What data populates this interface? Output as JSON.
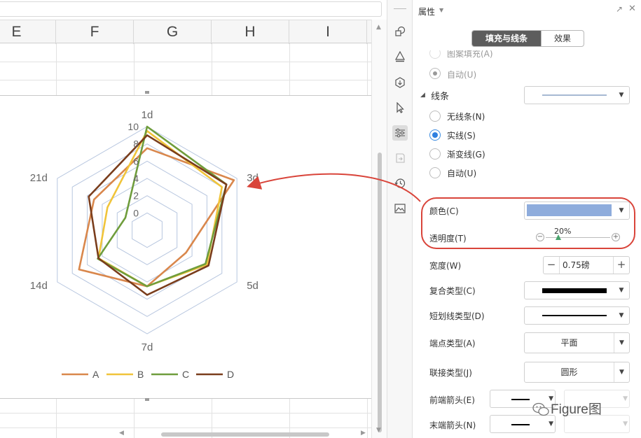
{
  "sheet": {
    "columns": [
      "E",
      "F",
      "G",
      "H",
      "I"
    ]
  },
  "chart_data": {
    "type": "radar",
    "categories": [
      "1d",
      "3d",
      "5d",
      "7d",
      "14d",
      "21d"
    ],
    "r_ticks": [
      "0",
      "2",
      "4",
      "6",
      "8",
      "10"
    ],
    "r_range": [
      -2,
      10
    ],
    "legend_position": "bottom",
    "series": [
      {
        "name": "A",
        "color": "#d9874c",
        "values": [
          7.5,
          9.6,
          3.2,
          4.5,
          7.1,
          5.1
        ]
      },
      {
        "name": "B",
        "color": "#f0c43a",
        "values": [
          9.5,
          8.0,
          6.0,
          4.5,
          4.5,
          3.3
        ]
      },
      {
        "name": "C",
        "color": "#6f9d3c",
        "values": [
          10.0,
          8.6,
          5.8,
          4.5,
          4.6,
          0.9
        ]
      },
      {
        "name": "D",
        "color": "#7a3d1c",
        "values": [
          9.0,
          8.6,
          6.2,
          5.5,
          4.5,
          5.8
        ]
      }
    ]
  },
  "toolbar": {
    "icons": [
      "shapes-icon",
      "fill-icon",
      "effects-icon",
      "select-icon",
      "properties-icon",
      "transform-icon",
      "history-icon",
      "image-icon"
    ]
  },
  "panel": {
    "title": "属性",
    "tabs": {
      "fill_line": "填充与线条",
      "effect": "效果"
    },
    "fill_radios": [
      {
        "label": "图案填充(A)",
        "checked": false
      },
      {
        "label": "自动(U)",
        "checked": true
      }
    ],
    "line_section": {
      "title": "线条",
      "line_color": "#a7b9d3"
    },
    "line_radios": [
      {
        "label": "无线条(N)",
        "checked": false
      },
      {
        "label": "实线(S)",
        "checked": true
      },
      {
        "label": "渐变线(G)",
        "checked": false
      },
      {
        "label": "自动(U)",
        "checked": false
      }
    ],
    "color": {
      "label": "颜色(C)",
      "value": "#8eacdc"
    },
    "transparency": {
      "label": "透明度(T)",
      "value": "20%",
      "fraction": 0.2
    },
    "width": {
      "label": "宽度(W)",
      "value": "0.75磅",
      "minus": "−",
      "plus": "+"
    },
    "compound": {
      "label": "复合类型(C)"
    },
    "dash": {
      "label": "短划线类型(D)"
    },
    "cap": {
      "label": "端点类型(A)",
      "value": "平面"
    },
    "join": {
      "label": "联接类型(J)",
      "value": "圆形"
    },
    "begin_arrow": {
      "label": "前端箭头(E)"
    },
    "end_arrow": {
      "label": "末端箭头(N)"
    }
  },
  "watermark": "Figure图",
  "colors": {
    "accent": "#2f80e0",
    "highlight": "#d9443a"
  }
}
